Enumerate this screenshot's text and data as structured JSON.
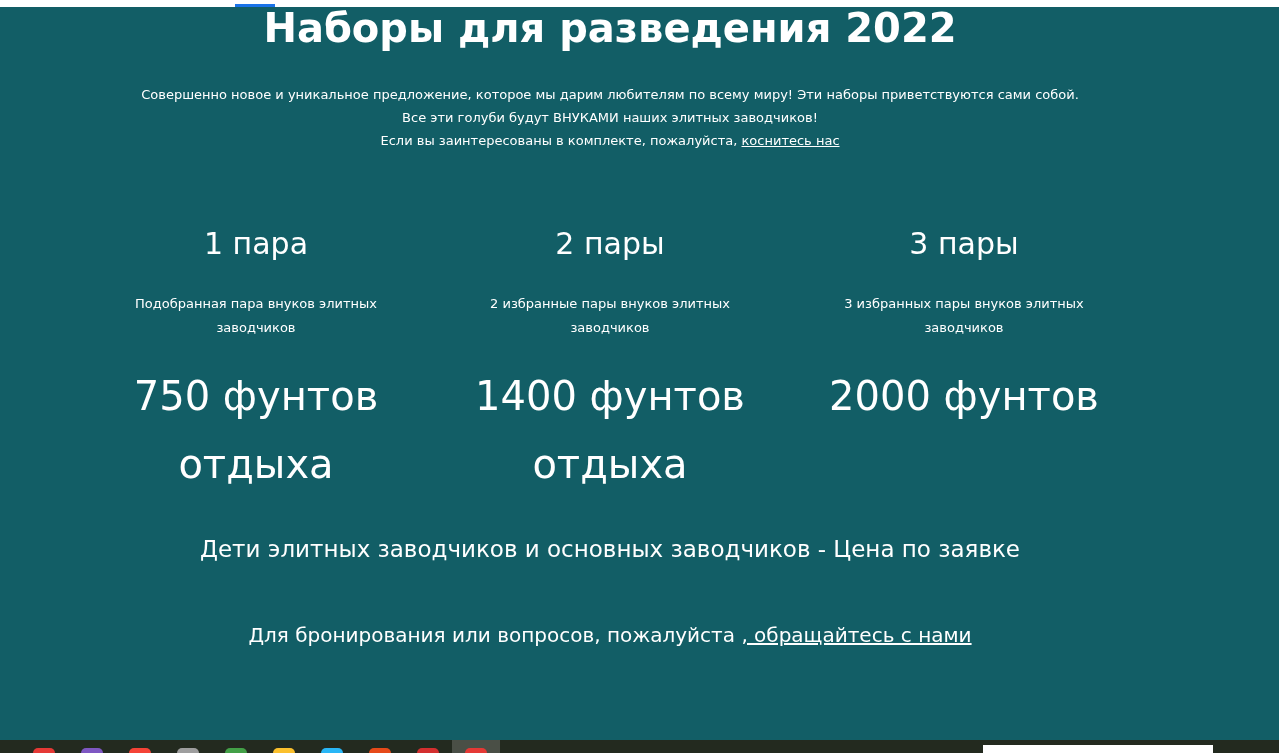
{
  "title": "Наборы для разведения 2022",
  "intro": {
    "lines": [
      "Совершенно новое и уникальное предложение, которое мы дарим любителям по всему миру! Эти наборы приветствуются сами собой.",
      "Все эти голуби будут ВНУКАМИ наших элитных заводчиков!"
    ],
    "contact_text": "Если вы заинтересованы в комплекте, пожалуйста, ",
    "contact_link": "коснитесь нас"
  },
  "packages": [
    {
      "name": "1 пара",
      "description": "Подобранная пара внуков элитных заводчиков",
      "price": "750 фунтов отдыха"
    },
    {
      "name": "2 пары",
      "description": "2 избранные пары внуков элитных заводчиков",
      "price": "1400 фунтов отдыха"
    },
    {
      "name": "3 пары",
      "description": "3 избранных пары внуков элитных заводчиков",
      "price": "2000 фунтов"
    }
  ],
  "children_note": "Дети элитных заводчиков и основных заводчиков - Цена по заявке",
  "booking": {
    "text": "Для бронирования или вопросов, пожалуйста ",
    "link": ", обращайтесь с нами"
  },
  "taskbar": {
    "apps": [
      {
        "color": "#e53935",
        "selected": false
      },
      {
        "color": "#7e57c2",
        "selected": false
      },
      {
        "color": "#f44336",
        "selected": false
      },
      {
        "color": "#9e9e9e",
        "selected": false
      },
      {
        "color": "#43a047",
        "selected": false
      },
      {
        "color": "#fbc02d",
        "selected": false
      },
      {
        "color": "#29b6f6",
        "selected": false
      },
      {
        "color": "#e64a19",
        "selected": false
      },
      {
        "color": "#d32f2f",
        "selected": false
      },
      {
        "color": "#e53935",
        "selected": true
      }
    ]
  }
}
